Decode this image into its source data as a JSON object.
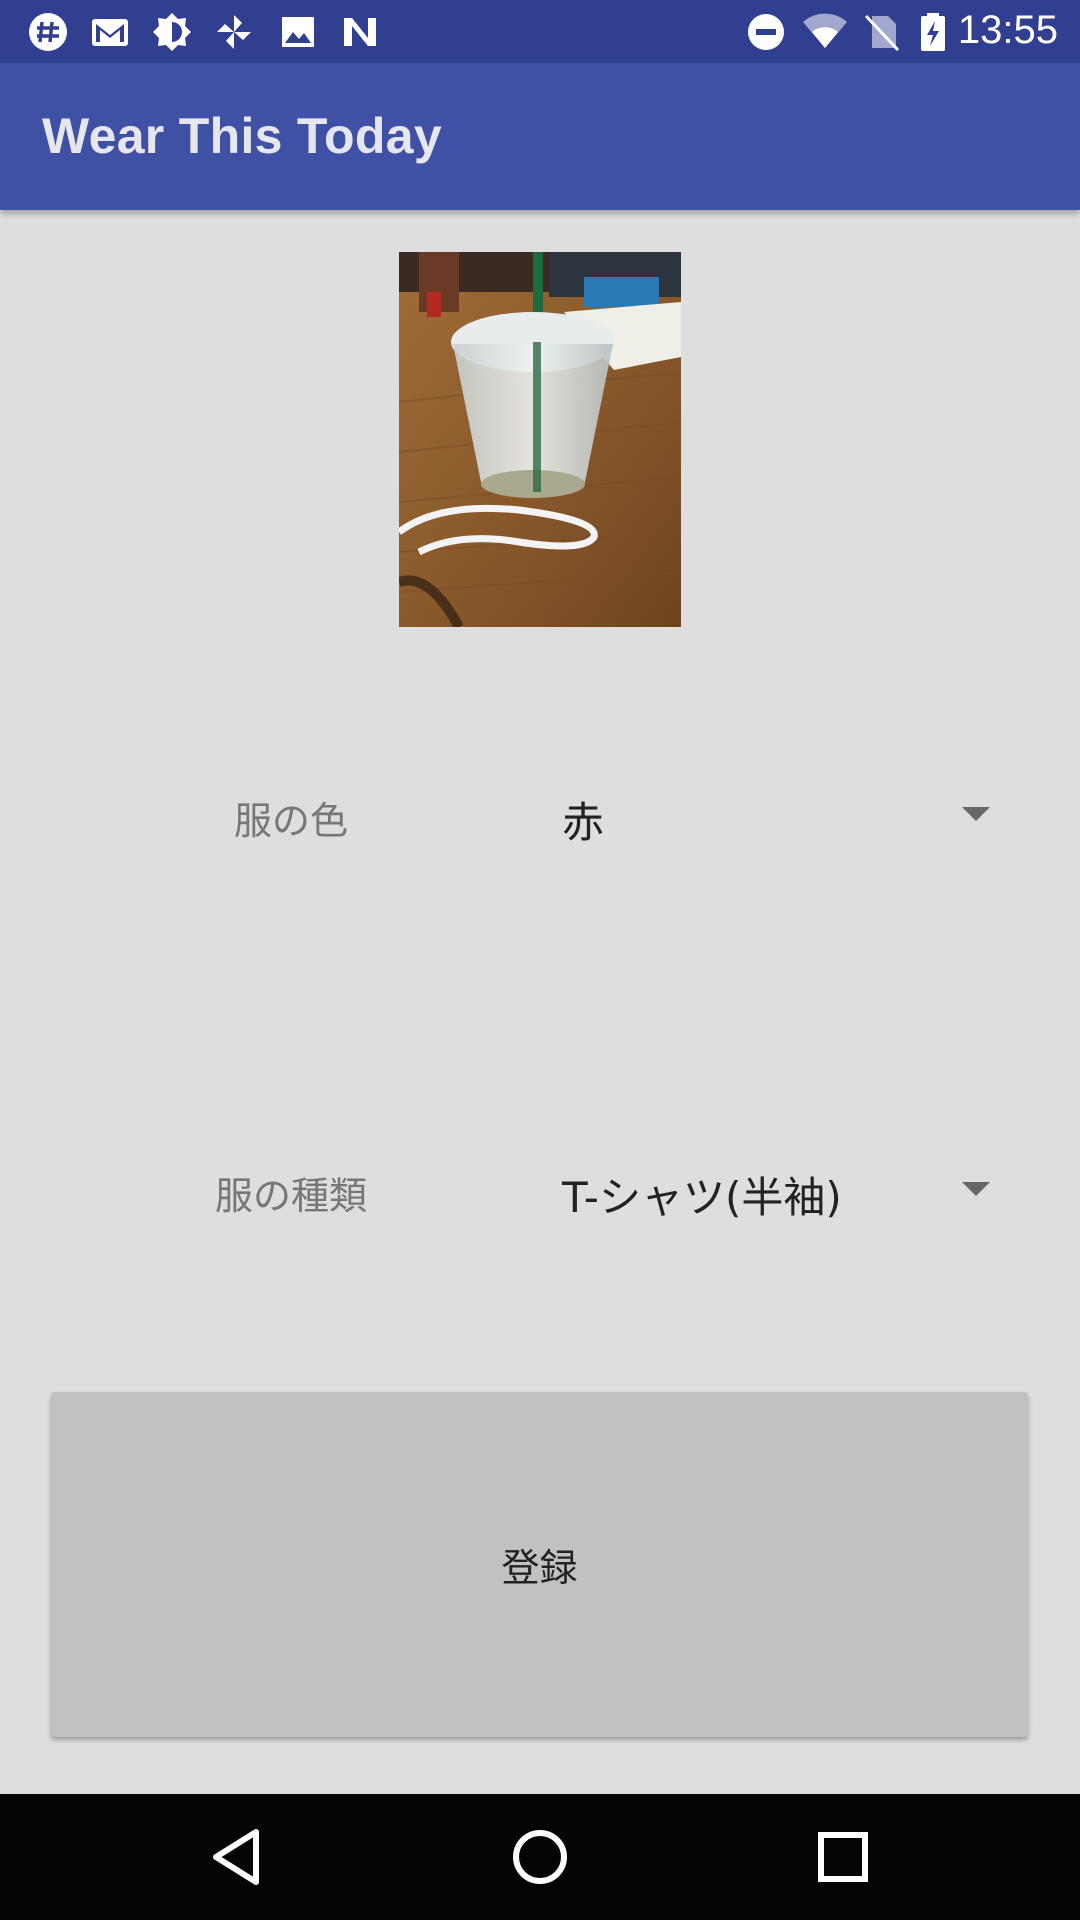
{
  "status_bar": {
    "time": "13:55",
    "left_icons": [
      "slack-icon",
      "gmail-icon",
      "brightness-icon",
      "pinwheel-icon",
      "image-icon",
      "n-icon"
    ],
    "right_icons": [
      "do-not-disturb-icon",
      "wifi-icon",
      "no-sim-icon",
      "battery-charging-icon"
    ]
  },
  "app_bar": {
    "title": "Wear This Today",
    "color": "#3f51a5"
  },
  "form": {
    "color_label": "服の色",
    "color_value": "赤",
    "type_label": "服の種類",
    "type_value": "T-シャツ(半袖)"
  },
  "register_button": {
    "label": "登録"
  },
  "nav_bar": {
    "icons": [
      "back-icon",
      "home-icon",
      "recents-icon"
    ]
  }
}
